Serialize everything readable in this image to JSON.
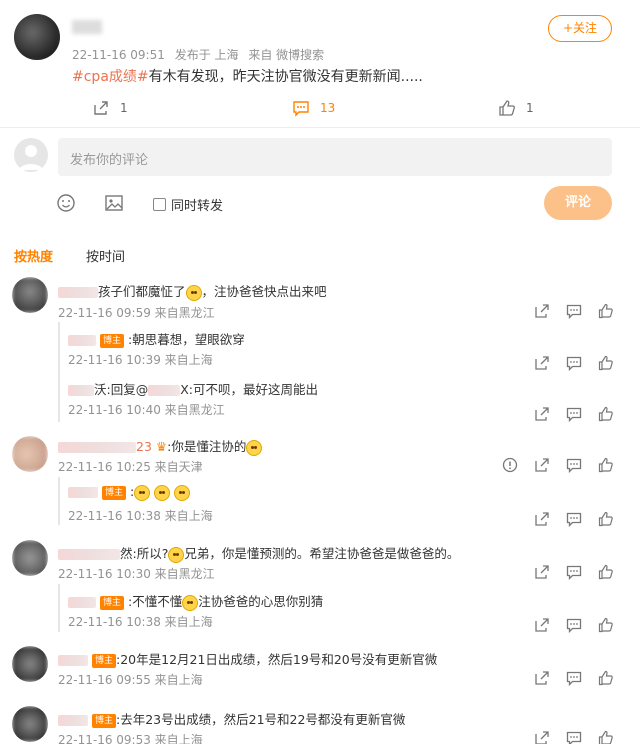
{
  "post": {
    "time": "22-11-16 09:51",
    "posted_from": "发布于 上海",
    "source": "来自 微博搜索",
    "follow_label": "+关注",
    "hashtag": "#cpa成绩#",
    "text": "有木有发现，昨天注协官微没有更新新闻.....",
    "repost_count": "1",
    "comment_count": "13",
    "like_count": "1"
  },
  "composer": {
    "placeholder": "发布你的评论",
    "repost_checkbox_label": "同时转发",
    "submit_label": "评论"
  },
  "sort_tabs": {
    "hot": "按热度",
    "time": "按时间"
  },
  "comments": [
    {
      "text_before": "孩子们都魔怔了",
      "text_after": "，注协爸爸快点出来吧",
      "meta": "22-11-16 09:59 来自黑龙江"
    },
    {
      "text": "23",
      "text2": ":你是懂注协的",
      "meta": "22-11-16 10:25 来自天津"
    },
    {
      "text": "然:所以?",
      "text2": "兄弟，你是懂预测的。希望注协爸爸是做爸爸的。",
      "meta": "22-11-16 10:30 来自黑龙江"
    },
    {
      "text": ":20年是12月21日出成绩，然后19号和20号没有更新官微",
      "meta": "22-11-16 09:55 来自上海"
    },
    {
      "text": ":去年23号出成绩，然后21号和22号都没有更新官微",
      "meta": "22-11-16 09:53 来自上海"
    }
  ],
  "replies": [
    {
      "text": ":朝思暮想，望眼欲穿",
      "meta": "22-11-16 10:39 来自上海"
    },
    {
      "prefix": "沃:回复@",
      "suffix": "X:可不呗，最好这周能出",
      "meta": "22-11-16 10:40 来自黑龙江"
    },
    {
      "text": ":",
      "meta": "22-11-16 10:38 来自上海"
    },
    {
      "text": ":不懂不懂",
      "text2": "注协爸爸的心思你别猜",
      "meta": "22-11-16 10:38 来自上海"
    }
  ],
  "badge_label": "博主",
  "colors": {
    "accent": "#ff8200",
    "meta": "#939393",
    "topic": "#eb7350"
  }
}
